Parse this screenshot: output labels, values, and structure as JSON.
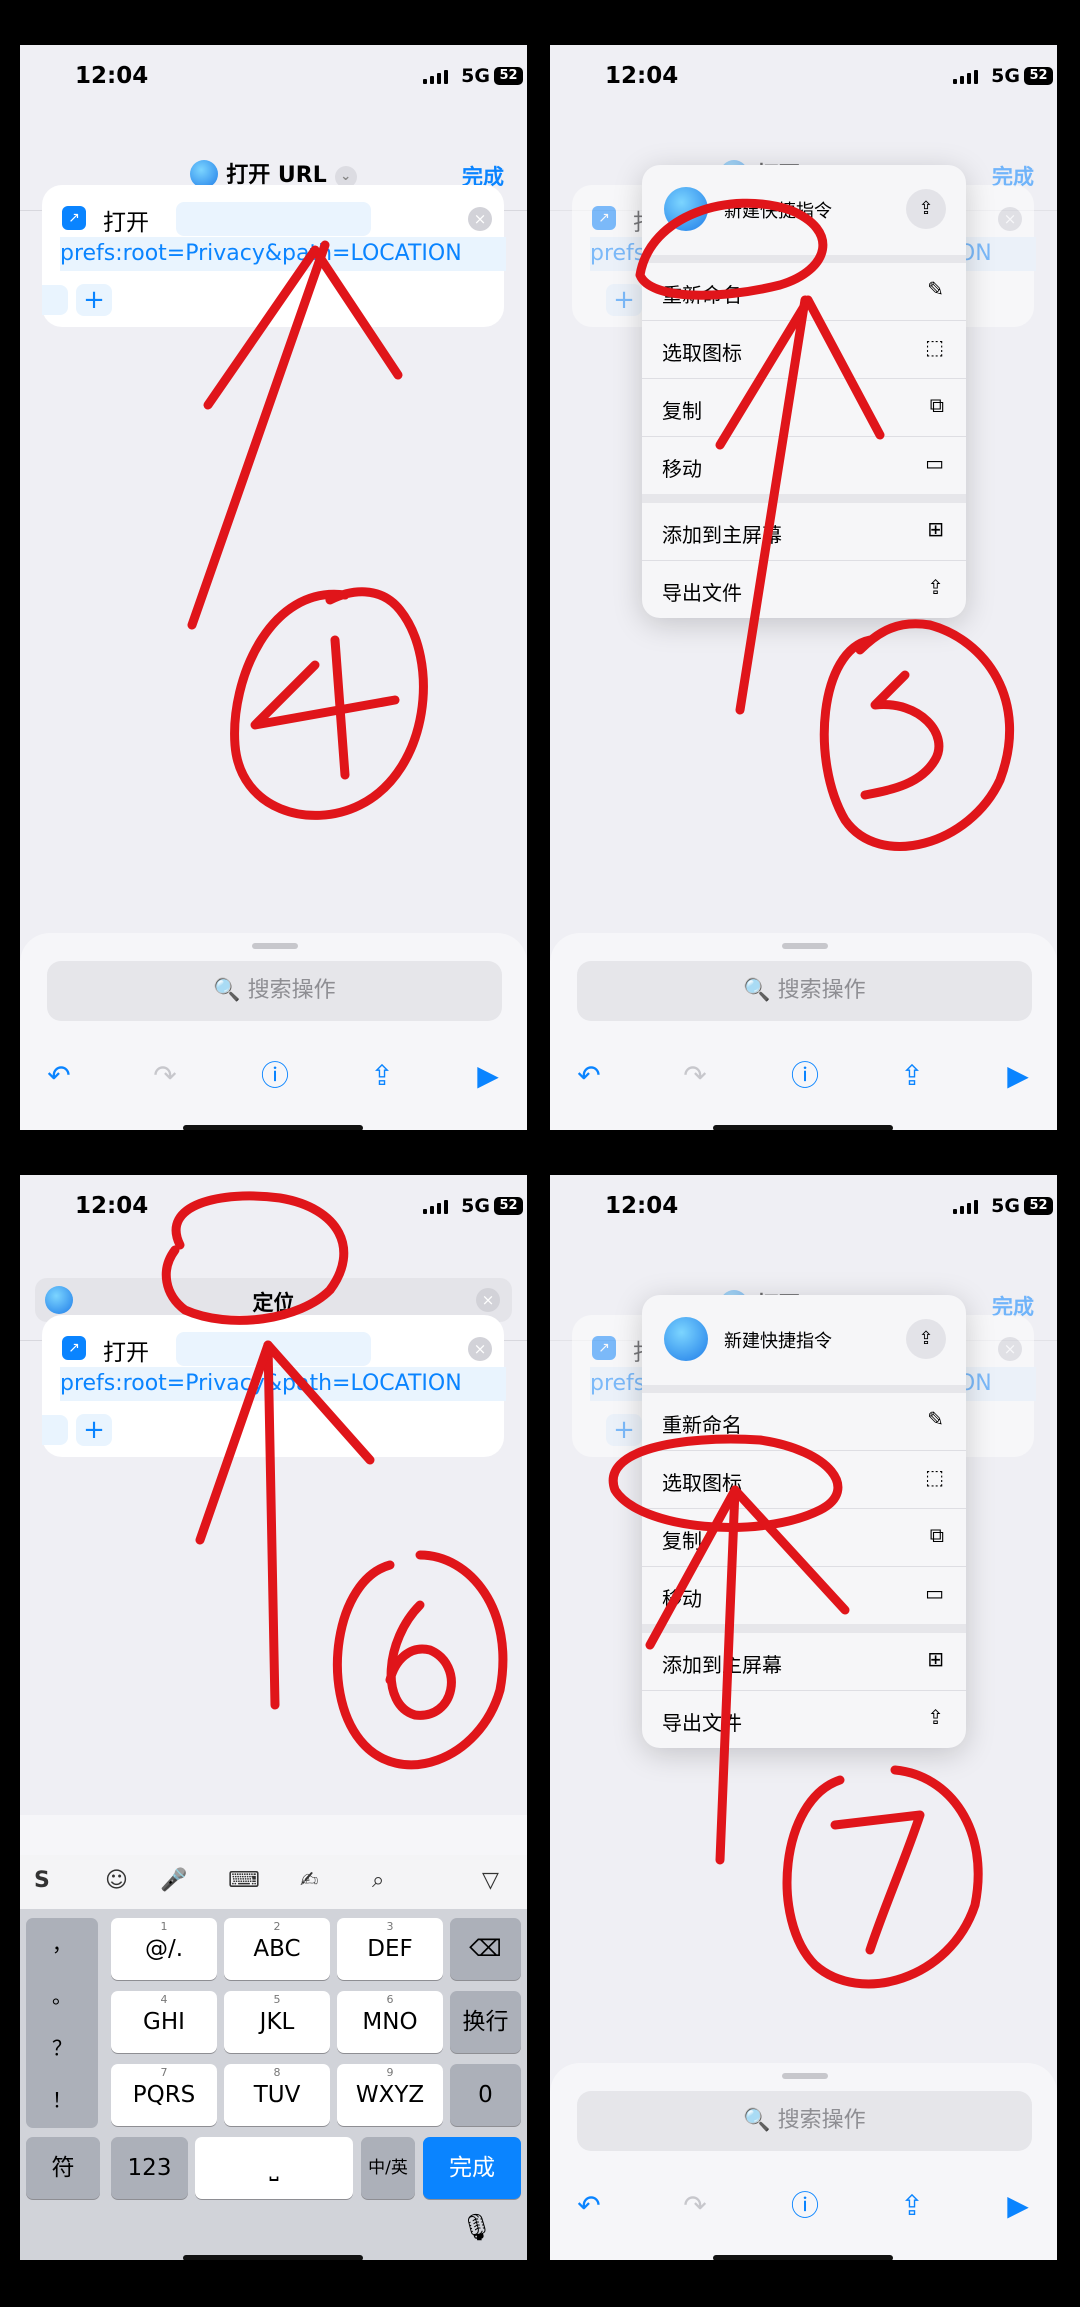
{
  "status": {
    "time": "12:04",
    "network": "5G",
    "battery": "52"
  },
  "nav": {
    "title": "打开 URL",
    "done": "完成",
    "chevron": "⌄"
  },
  "action": {
    "title": "打开",
    "url": "prefs:root=Privacy&path=LOCATION",
    "plus": "+",
    "clear": "×"
  },
  "sheet": {
    "search": "🔍 搜索操作"
  },
  "toolbar": {
    "undo": "↶",
    "redo": "↷",
    "info": "ⓘ",
    "share": "⇪",
    "play": "▶"
  },
  "menu": {
    "title": "新建快捷指令",
    "items": [
      {
        "label": "重新命名",
        "icon": "✎"
      },
      {
        "label": "选取图标",
        "icon": "⬚"
      },
      {
        "label": "复制",
        "icon": "⧉"
      },
      {
        "label": "移动",
        "icon": "▭"
      },
      {
        "label": "添加到主屏幕",
        "icon": "⊞"
      },
      {
        "label": "导出文件",
        "icon": "⇪"
      }
    ]
  },
  "rename": {
    "value": "定位"
  },
  "keyboard": {
    "side": [
      "，",
      "。",
      "？",
      "！"
    ],
    "row1": [
      {
        "sub": "1",
        "main": "@/."
      },
      {
        "sub": "2",
        "main": "ABC"
      },
      {
        "sub": "3",
        "main": "DEF"
      }
    ],
    "row2": [
      {
        "sub": "4",
        "main": "GHI"
      },
      {
        "sub": "5",
        "main": "JKL"
      },
      {
        "sub": "6",
        "main": "MNO"
      }
    ],
    "row3": [
      {
        "sub": "7",
        "main": "PQRS"
      },
      {
        "sub": "8",
        "main": "TUV"
      },
      {
        "sub": "9",
        "main": "WXYZ"
      }
    ],
    "backspace": "⌫",
    "newline": "换行",
    "zero": "0",
    "symbol": "符",
    "num": "123",
    "space": "⎵",
    "lang": "中/英",
    "done": "完成"
  },
  "annotations": [
    "④",
    "⑤",
    "⑥",
    "⑦"
  ],
  "colors": {
    "accent": "#0a84ff",
    "annotation": "#e0151a"
  }
}
